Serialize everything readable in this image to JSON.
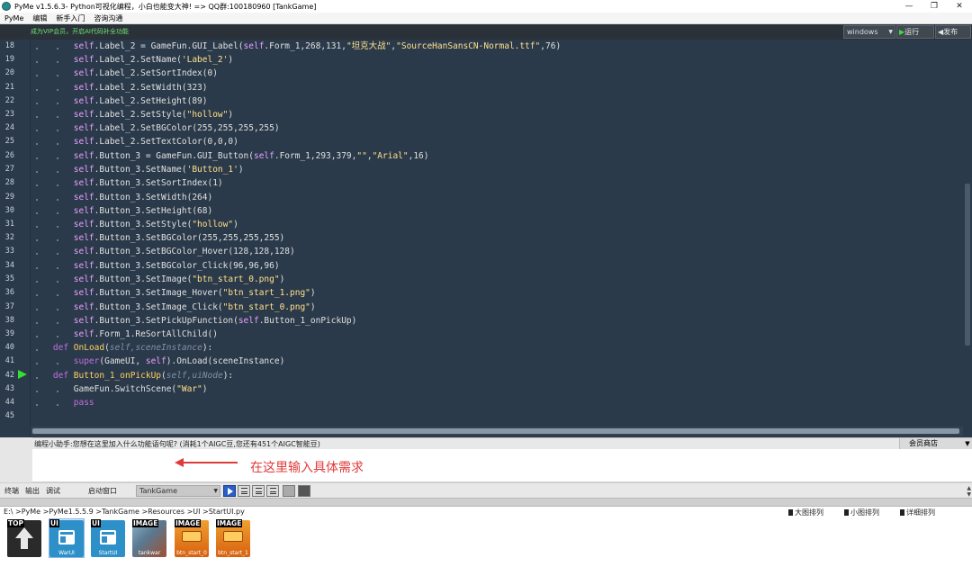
{
  "window": {
    "title": "PyMe v1.5.6.3- Python可视化编程，小白也能变大神!  => QQ群:100180960   [TankGame]",
    "controls": [
      "—",
      "❐",
      "✕"
    ]
  },
  "menu": [
    "PyMe",
    "编辑",
    "新手入门",
    "咨询沟通"
  ],
  "toolbar": {
    "vip_text": "成为VIP会员，开启AI代码补全功能",
    "platform": "windows",
    "run_label": "运行",
    "publish_label": "发布"
  },
  "editor": {
    "line_numbers": [
      "18",
      "19",
      "20",
      "21",
      "22",
      "23",
      "24",
      "25",
      "26",
      "27",
      "28",
      "29",
      "30",
      "31",
      "32",
      "33",
      "34",
      "35",
      "36",
      "37",
      "38",
      "39",
      "40",
      "41",
      "42",
      "43",
      "44",
      "45"
    ],
    "breakpoint_line": "42"
  },
  "assistant": {
    "prompt": "编程小助手:您想在这里加入什么功能语句呢? (消耗1个AIGC豆,您还有451个AIGC智能豆)",
    "shop_label": "会员商店",
    "hint": "在这里输入具体需求"
  },
  "bottom_tabs": {
    "tabs": [
      "终端",
      "输出",
      "调试"
    ],
    "start_window_label": "启动窗口",
    "scene": "TankGame"
  },
  "files": {
    "path": "E:\\ >PyMe >PyMe1.5.5.9 >TankGame >Resources >UI >StartUI.py",
    "view_options": [
      "大图排列",
      "小图排列",
      "详细排列"
    ],
    "items": [
      {
        "type": "TOP",
        "name": ""
      },
      {
        "type": "UI",
        "name": "WarUI"
      },
      {
        "type": "UI",
        "name": "StartUI"
      },
      {
        "type": "IMAGE",
        "name": "tankwar"
      },
      {
        "type": "IMAGE",
        "name": "btn_start_0"
      },
      {
        "type": "IMAGE",
        "name": "btn_start_1"
      }
    ]
  },
  "colors": {
    "editor_bg": "#2b3a4a",
    "keyword": "#c070e0",
    "self": "#e8a0ff",
    "function": "#ffd060",
    "string": "#ffe08a",
    "run_icon": "#3ddc3d",
    "hint": "#e03b3b"
  }
}
